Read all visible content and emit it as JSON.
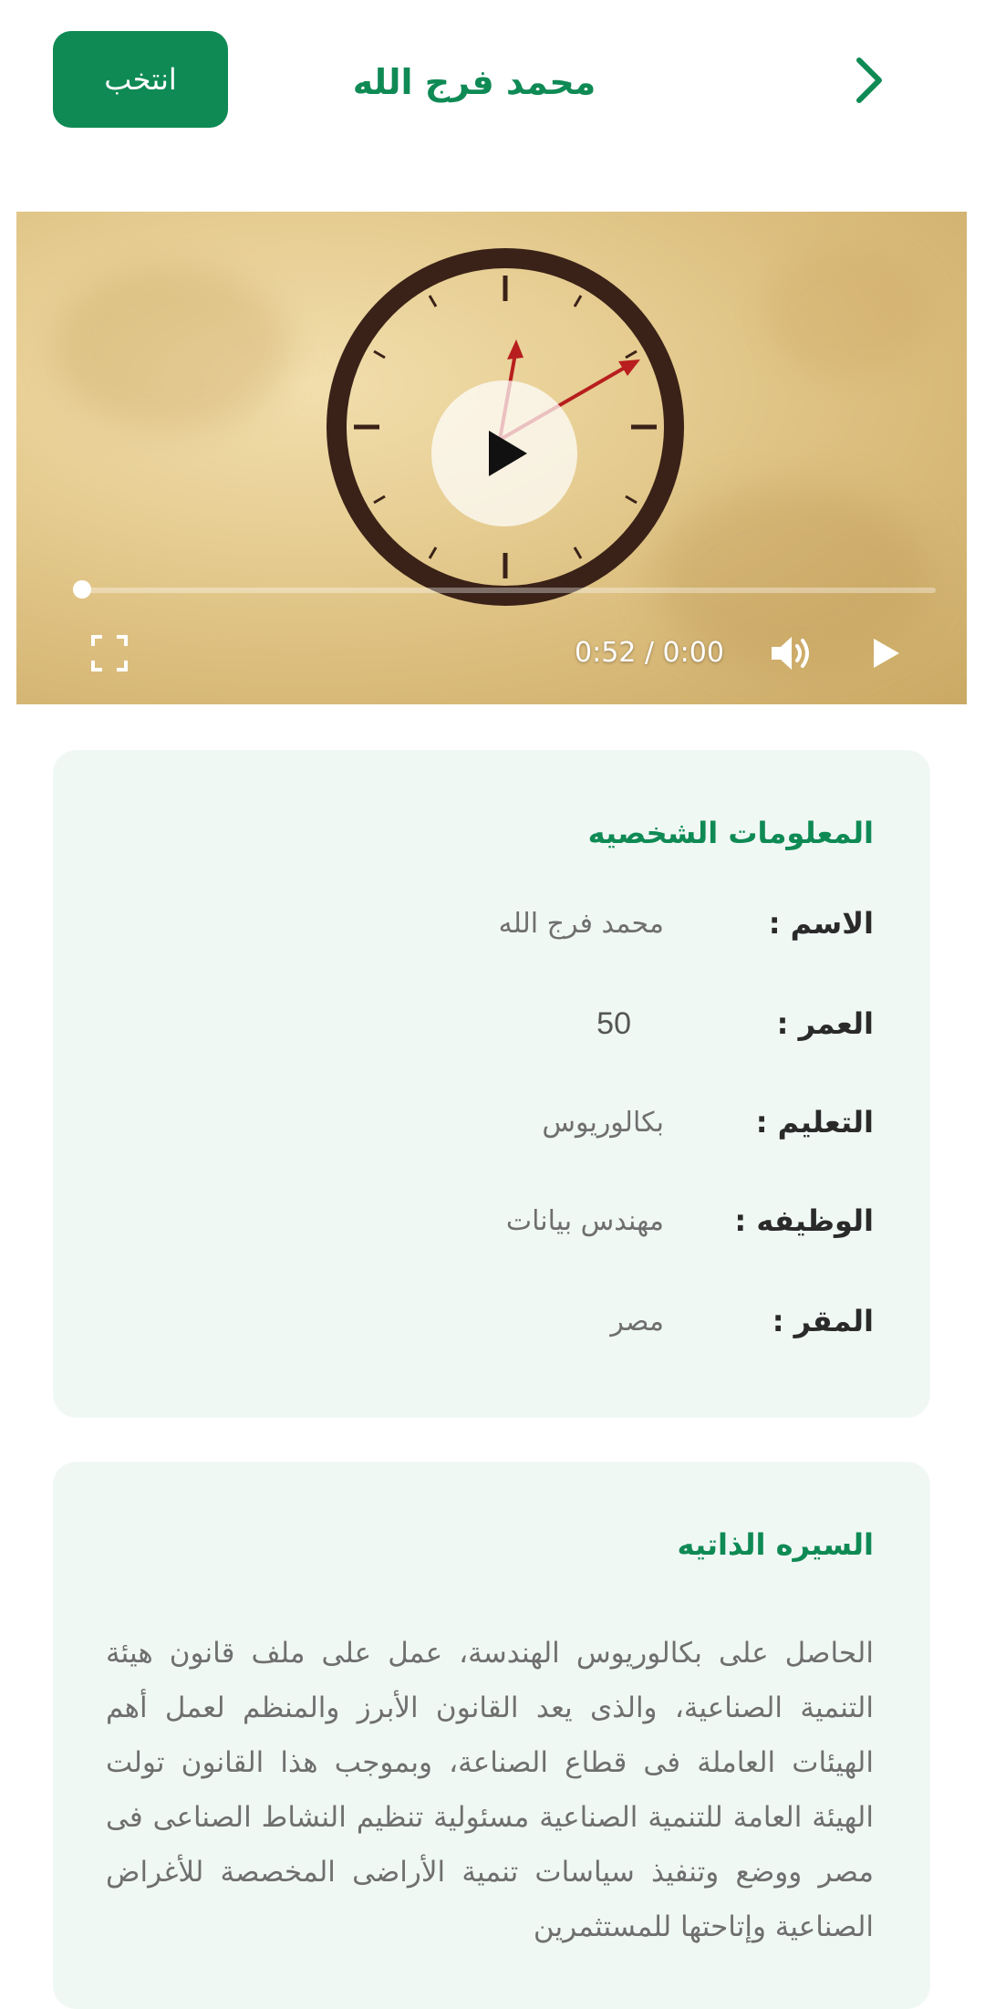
{
  "header": {
    "title": "محمد فرج الله",
    "vote_label": "انتخب",
    "back_icon": "chevron-right-icon"
  },
  "video": {
    "time_display": "0:52 / 0:00",
    "progress": 0.0,
    "controls": {
      "fullscreen_icon": "fullscreen-icon",
      "volume_icon": "volume-icon",
      "play_icon": "play-icon"
    }
  },
  "personal_info": {
    "title": "المعلومات الشخصيه",
    "rows": [
      {
        "label": "الاسم :",
        "value": "محمد فرج الله"
      },
      {
        "label": "العمر :",
        "value": "50"
      },
      {
        "label": "التعليم :",
        "value": "بكالوريوس"
      },
      {
        "label": "الوظيفه :",
        "value": "مهندس بيانات"
      },
      {
        "label": "المقر :",
        "value": "مصر"
      }
    ]
  },
  "bio": {
    "title": "السيره الذاتيه",
    "text": "الحاصل على بكالوريوس الهندسة، عمل على ملف قانون هيئة التنمية الصناعية، والذى يعد القانون الأبرز والمنظم لعمل أهم الهيئات العاملة فى قطاع الصناعة، وبموجب هذا القانون تولت الهيئة العامة للتنمية الصناعية مسئولية تنظيم النشاط الصناعى فى مصر ووضع وتنفيذ سياسات تنمية الأراضى المخصصة للأغراض الصناعية وإتاحتها للمستثمرين"
  },
  "colors": {
    "brand_green": "#0f8a55",
    "card_background": "#f0f8f4"
  }
}
